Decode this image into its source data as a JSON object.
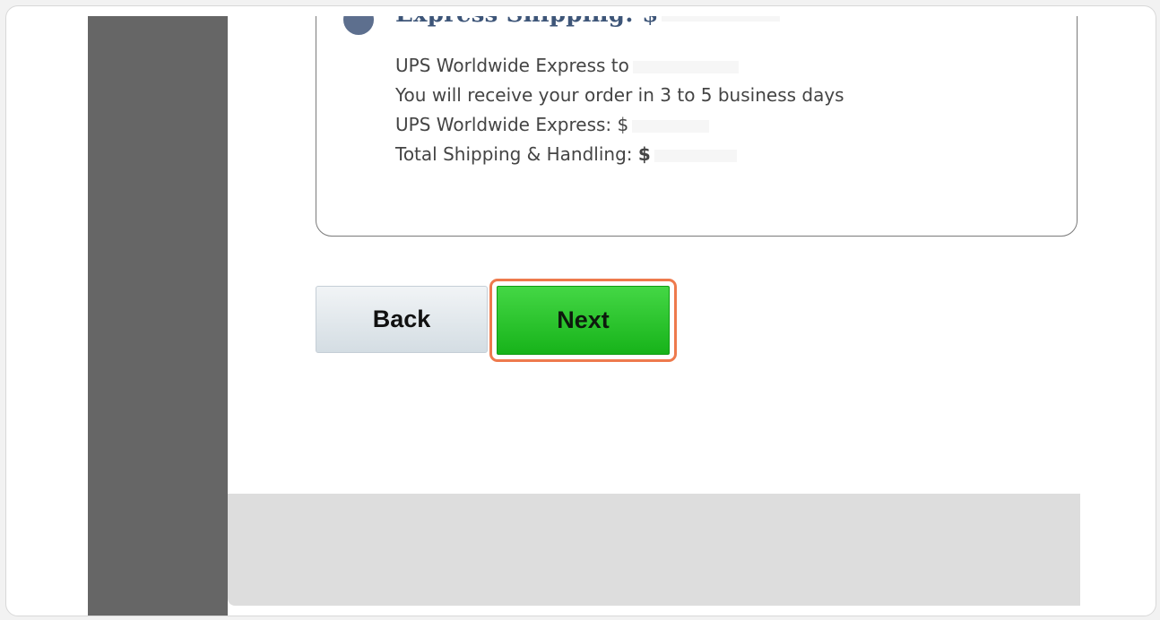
{
  "shipping_option": {
    "title": "Express Shipping: $",
    "lines": [
      "UPS Worldwide Express to",
      "You will receive your order in 3 to 5 business days",
      "UPS Worldwide Express: $",
      "Total Shipping & Handling: "
    ],
    "total_currency": "$"
  },
  "buttons": {
    "back_label": "Back",
    "next_label": "Next"
  },
  "colors": {
    "radio": "#5d6f8e",
    "title": "#3d5578",
    "next_green": "#22bb22",
    "highlight": "#ee7a4d",
    "gutter": "#666666",
    "footer": "#dddddd"
  }
}
